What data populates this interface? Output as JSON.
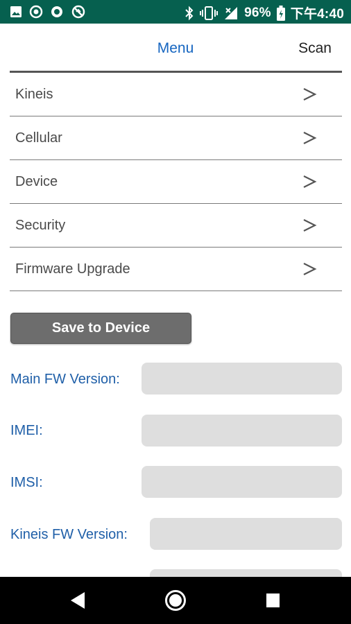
{
  "status_bar": {
    "battery_percent": "96%",
    "time": "下午4:40",
    "left_icons": [
      "image-icon",
      "target-icon",
      "circle-icon",
      "no-signal-icon"
    ],
    "right_icons": [
      "bluetooth-icon",
      "vibrate-icon",
      "cell-signal-icon",
      "battery-icon"
    ]
  },
  "header": {
    "title": "Menu",
    "action": "Scan"
  },
  "menu": {
    "items": [
      {
        "label": "Kineis"
      },
      {
        "label": "Cellular"
      },
      {
        "label": "Device"
      },
      {
        "label": "Security"
      },
      {
        "label": "Firmware Upgrade"
      }
    ],
    "chevron_icon": "chevron-right-icon"
  },
  "save_button": {
    "label": "Save to Device"
  },
  "info": {
    "main_fw_version": {
      "label": "Main FW Version:",
      "value": ""
    },
    "imei": {
      "label": "IMEI:",
      "value": ""
    },
    "imsi": {
      "label": "IMSI:",
      "value": ""
    },
    "kineis_fw_version": {
      "label": "Kineis FW Version:",
      "value": ""
    }
  },
  "nav": {
    "icons": [
      "back-icon",
      "home-icon",
      "recents-icon"
    ]
  },
  "colors": {
    "status_bar": "#06604f",
    "header_title": "#1565c0",
    "label_blue": "#1f5fa8",
    "button_gray": "#6d6d6d",
    "field_gray": "#dedede"
  }
}
